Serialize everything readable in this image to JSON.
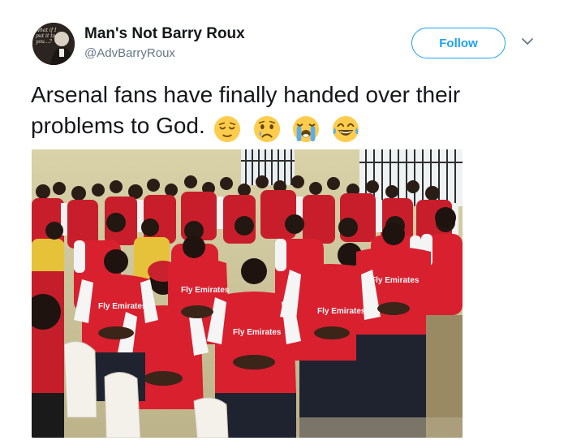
{
  "tweet": {
    "author": {
      "display_name": "Man's Not Barry Roux",
      "screen_name": "@AdvBarryRoux",
      "avatar_text": "what if I put it to you...?"
    },
    "follow_label": "Follow",
    "text": "Arsenal fans have finally handed over their problems to God.",
    "emojis": [
      "relieved-face",
      "crying-face",
      "loudly-crying-face",
      "face-with-tears-of-joy"
    ],
    "media": {
      "shirt_text": "Fly Emirates"
    }
  },
  "colors": {
    "accent": "#1da1f2",
    "text": "#14171a",
    "secondary_text": "#657786",
    "arsenal_red": "#d8202f"
  }
}
